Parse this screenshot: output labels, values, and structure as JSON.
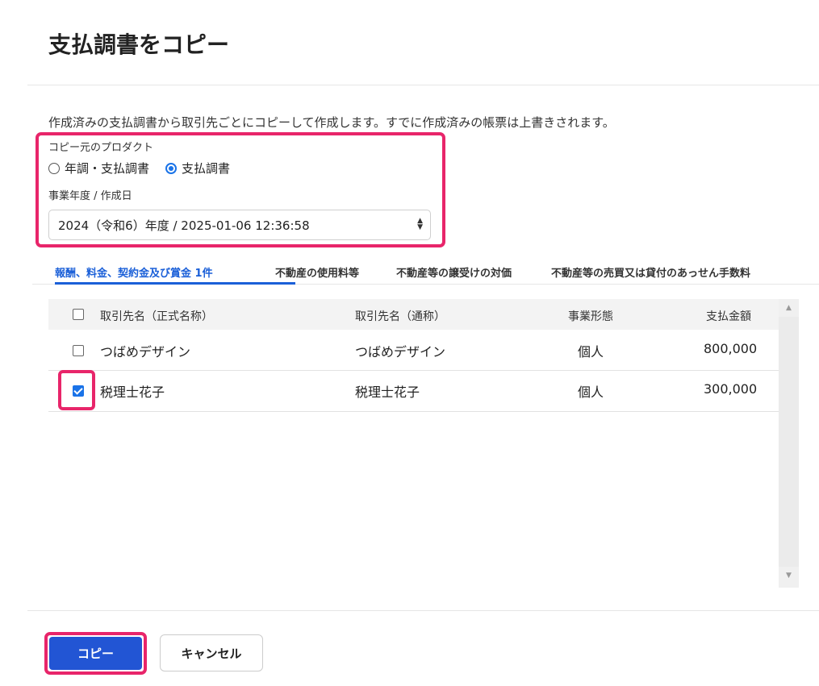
{
  "dialog": {
    "title": "支払調書をコピー",
    "description": "作成済みの支払調書から取引先ごとにコピーして作成します。すでに作成済みの帳票は上書きされます。"
  },
  "source": {
    "label": "コピー元のプロダクト",
    "options": [
      {
        "label": "年調・支払調書",
        "checked": false
      },
      {
        "label": "支払調書",
        "checked": true
      }
    ]
  },
  "year": {
    "label": "事業年度 / 作成日",
    "selected": "2024（令和6）年度 / 2025-01-06 12:36:58"
  },
  "tabs": [
    {
      "label": "報酬、料金、契約金及び賞金  1件",
      "active": true
    },
    {
      "label": "不動産の使用料等",
      "active": false
    },
    {
      "label": "不動産等の譲受けの対価",
      "active": false
    },
    {
      "label": "不動産等の売買又は貸付のあっせん手数料",
      "active": false
    }
  ],
  "table": {
    "headers": {
      "official_name": "取引先名（正式名称）",
      "common_name": "取引先名（通称）",
      "business_type": "事業形態",
      "amount": "支払金額"
    },
    "rows": [
      {
        "checked": false,
        "official_name": "つばめデザイン",
        "common_name": "つばめデザイン",
        "business_type": "個人",
        "amount": "800,000"
      },
      {
        "checked": true,
        "official_name": "税理士花子",
        "common_name": "税理士花子",
        "business_type": "個人",
        "amount": "300,000"
      }
    ]
  },
  "buttons": {
    "copy": "コピー",
    "cancel": "キャンセル"
  },
  "colors": {
    "accent": "#2255d4",
    "highlight": "#e8256a",
    "tab_active": "#1a5fd8"
  }
}
